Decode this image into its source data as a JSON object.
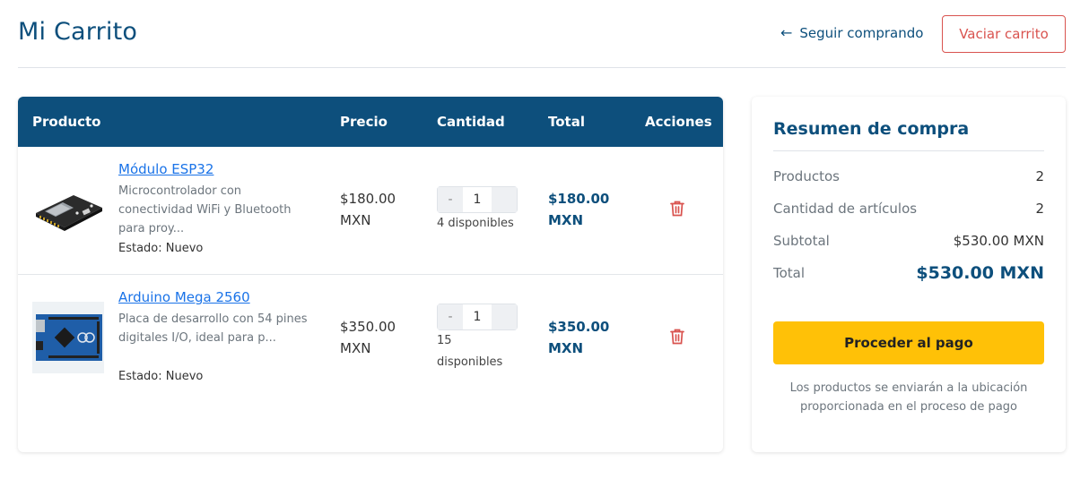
{
  "header": {
    "title": "Mi Carrito",
    "continue_label": "Seguir comprando",
    "empty_label": "Vaciar carrito"
  },
  "table": {
    "headers": [
      "Producto",
      "Precio",
      "Cantidad",
      "Total",
      "Acciones"
    ],
    "rows": [
      {
        "name": "Módulo ESP32",
        "description": "Microcontrolador con conectividad WiFi y Bluetooth para proy...",
        "state": "Estado: Nuevo",
        "price": "$180.00 MXN",
        "qty": "1",
        "stock": "4 disponibles",
        "total": "$180.00 MXN",
        "image": "esp32-board"
      },
      {
        "name": "Arduino Mega 2560",
        "description": "Placa de desarrollo con 54 pines digitales I/O, ideal para p...",
        "state": "Estado: Nuevo",
        "price": "$350.00 MXN",
        "qty": "1",
        "stock": "15 disponibles",
        "total": "$350.00 MXN",
        "image": "arduino-mega-board"
      }
    ],
    "minus": "-",
    "plus": "+"
  },
  "summary": {
    "title": "Resumen de compra",
    "products_label": "Productos",
    "products_value": "2",
    "items_label": "Cantidad de artículos",
    "items_value": "2",
    "subtotal_label": "Subtotal",
    "subtotal_value": "$530.00 MXN",
    "total_label": "Total",
    "total_value": "$530.00 MXN",
    "pay_label": "Proceder al pago",
    "note": "Los productos se enviarán a la ubicación proporcionada en el proceso de pago"
  },
  "colors": {
    "primary": "#0d4f7c",
    "danger": "#d9534f",
    "accent": "#ffc107",
    "link": "#1a73e8"
  },
  "icons": {
    "back": "arrow-left-icon",
    "delete": "trash-icon"
  }
}
